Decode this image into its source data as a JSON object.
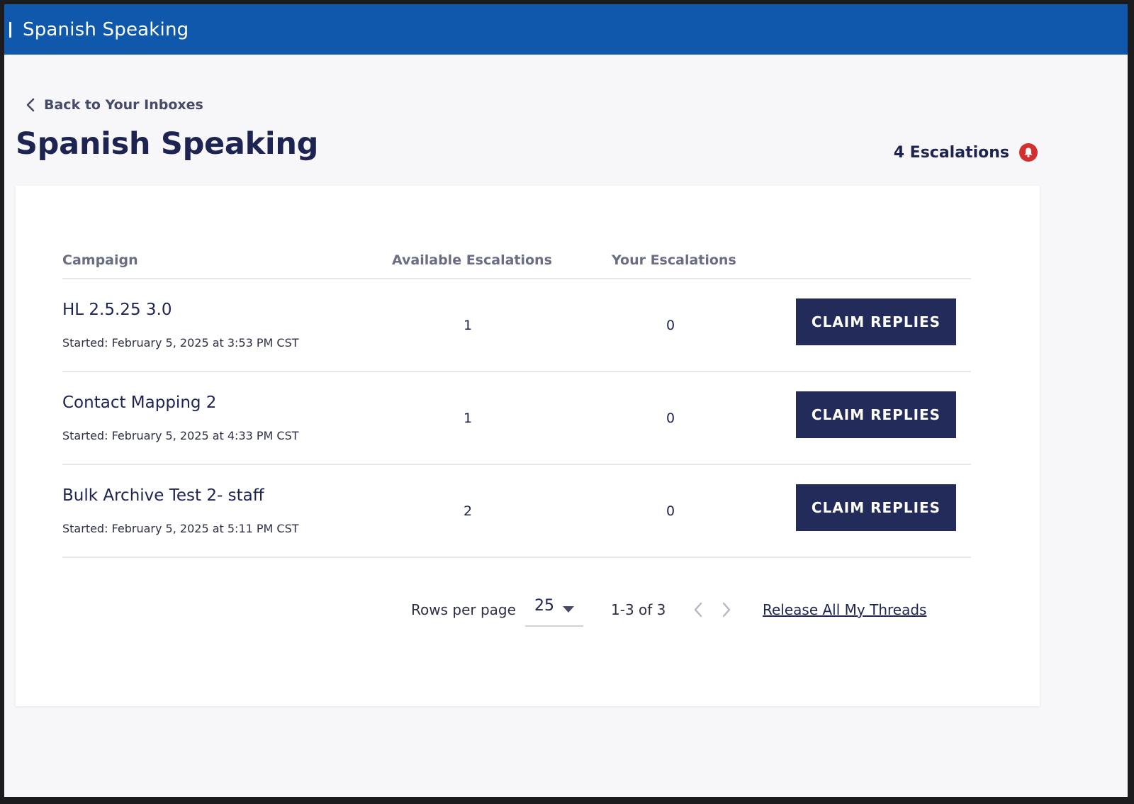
{
  "header": {
    "title": "Spanish Speaking"
  },
  "back_link": {
    "label": "Back to Your Inboxes"
  },
  "page": {
    "title": "Spanish Speaking"
  },
  "escalations": {
    "label": "4 Escalations"
  },
  "table": {
    "columns": {
      "campaign": "Campaign",
      "available": "Available Escalations",
      "yours": "Your Escalations"
    },
    "rows": [
      {
        "name": "HL 2.5.25 3.0",
        "started": "Started: February 5, 2025 at 3:53 PM CST",
        "available": "1",
        "yours": "0",
        "button": "CLAIM REPLIES"
      },
      {
        "name": "Contact Mapping 2",
        "started": "Started: February 5, 2025 at 4:33 PM CST",
        "available": "1",
        "yours": "0",
        "button": "CLAIM REPLIES"
      },
      {
        "name": "Bulk Archive Test 2- staff",
        "started": "Started: February 5, 2025 at 5:11 PM CST",
        "available": "2",
        "yours": "0",
        "button": "CLAIM REPLIES"
      }
    ]
  },
  "pagination": {
    "rows_per_page_label": "Rows per page",
    "rows_per_page_value": "25",
    "range": "1-3 of 3",
    "release_label": "Release All My Threads"
  },
  "colors": {
    "header_bg": "#0f58ac",
    "title_navy": "#1d2452",
    "button_bg": "#232b5a",
    "alert_red": "#d32f2f"
  }
}
